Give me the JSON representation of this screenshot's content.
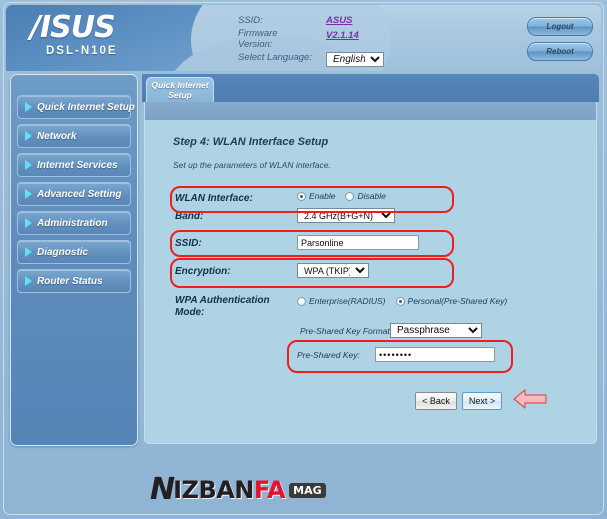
{
  "brand": {
    "logo_text": "/ISUS",
    "model": "DSL-N10E"
  },
  "header": {
    "ssid_label": "SSID:",
    "ssid_value": "ASUS",
    "firmware_label_line1": "Firmware",
    "firmware_label_line2": "Version:",
    "firmware_value": "V2.1.14",
    "language_label": "Select Language:",
    "language_value": "English",
    "language_options": [
      "English"
    ],
    "logout_label": "Logout",
    "reboot_label": "Reboot"
  },
  "sidebar": {
    "items": [
      {
        "label": "Quick Internet Setup",
        "icon": "triangle-right-icon"
      },
      {
        "label": "Network",
        "icon": "triangle-right-icon"
      },
      {
        "label": "Internet Services",
        "icon": "triangle-right-icon"
      },
      {
        "label": "Advanced Setting",
        "icon": "triangle-right-icon"
      },
      {
        "label": "Administration",
        "icon": "triangle-right-icon"
      },
      {
        "label": "Diagnostic",
        "icon": "triangle-right-icon"
      },
      {
        "label": "Router Status",
        "icon": "triangle-right-icon"
      }
    ]
  },
  "tab": {
    "line1": "Quick Internet",
    "line2": "Setup"
  },
  "main": {
    "step_title": "Step 4: WLAN Interface Setup",
    "step_desc": "Set up the parameters of WLAN interface.",
    "wlan_interface_label": "WLAN Interface:",
    "wlan_enable_label": "Enable",
    "wlan_disable_label": "Disable",
    "wlan_selected": "Enable",
    "band_label": "Band:",
    "band_value": "2.4 GHz(B+G+N)",
    "band_options": [
      "2.4 GHz(B+G+N)"
    ],
    "ssid_label": "SSID:",
    "ssid_value": "Parsonline",
    "encryption_label": "Encryption:",
    "encryption_value": "WPA (TKIP)",
    "encryption_options": [
      "WPA (TKIP)"
    ],
    "wpa_mode_label_line1": "WPA Authentication",
    "wpa_mode_label_line2": "Mode:",
    "wpa_enterprise_label": "Enterprise(RADIUS)",
    "wpa_personal_label": "Personal(Pre-Shared Key)",
    "wpa_mode_selected": "Personal(Pre-Shared Key)",
    "psk_format_label": "Pre-Shared Key Format:",
    "psk_format_value": "Passphrase",
    "psk_format_options": [
      "Passphrase"
    ],
    "psk_label": "Pre-Shared Key:",
    "psk_value": "••••••••",
    "back_label": "< Back",
    "next_label": "Next >"
  },
  "annotations": {
    "arrow": "left-arrow-annotation",
    "highlight_color": "#ef1d1d",
    "arrow_color": "#f3a9ad"
  },
  "watermark": {
    "initial": "N",
    "part1": "IZBAN",
    "part2": "FA",
    "badge": "MAG"
  }
}
